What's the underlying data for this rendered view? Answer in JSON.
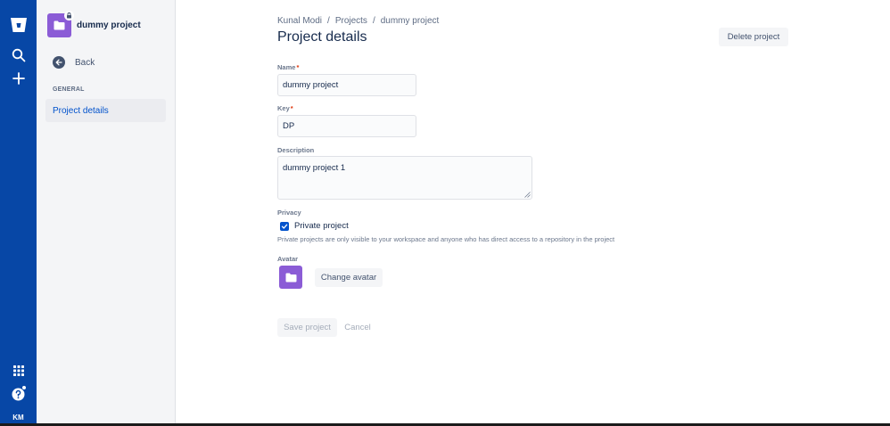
{
  "project": {
    "name": "dummy project"
  },
  "global_nav": {
    "logo_icon": "bitbucket-logo-icon",
    "search_icon": "search-icon",
    "create_icon": "plus-icon",
    "apps_icon": "app-switcher-icon",
    "help_icon": "help-icon",
    "user_initials": "KM"
  },
  "sidebar": {
    "back_label": "Back",
    "section_title": "GENERAL",
    "items": [
      {
        "label": "Project details",
        "selected": true
      }
    ]
  },
  "breadcrumb": {
    "items": [
      "Kunal Modi",
      "Projects",
      "dummy project"
    ],
    "separator": "/"
  },
  "header": {
    "title": "Project details",
    "delete_label": "Delete project"
  },
  "form": {
    "name": {
      "label": "Name",
      "required_mark": "*",
      "value": "dummy project"
    },
    "key": {
      "label": "Key",
      "required_mark": "*",
      "value": "DP"
    },
    "description": {
      "label": "Description",
      "value": "dummy project 1"
    },
    "privacy": {
      "label": "Privacy",
      "checkbox_label": "Private project",
      "checked": true,
      "helper": "Private projects are only visible to your workspace and anyone who has direct access to a repository in the project"
    },
    "avatar": {
      "label": "Avatar",
      "change_label": "Change avatar"
    },
    "actions": {
      "save_label": "Save project",
      "cancel_label": "Cancel"
    }
  },
  "colors": {
    "nav_blue": "#0747a6",
    "avatar_purple": "#8b5cd6",
    "link_blue": "#0052cc",
    "required_red": "#de350b"
  }
}
